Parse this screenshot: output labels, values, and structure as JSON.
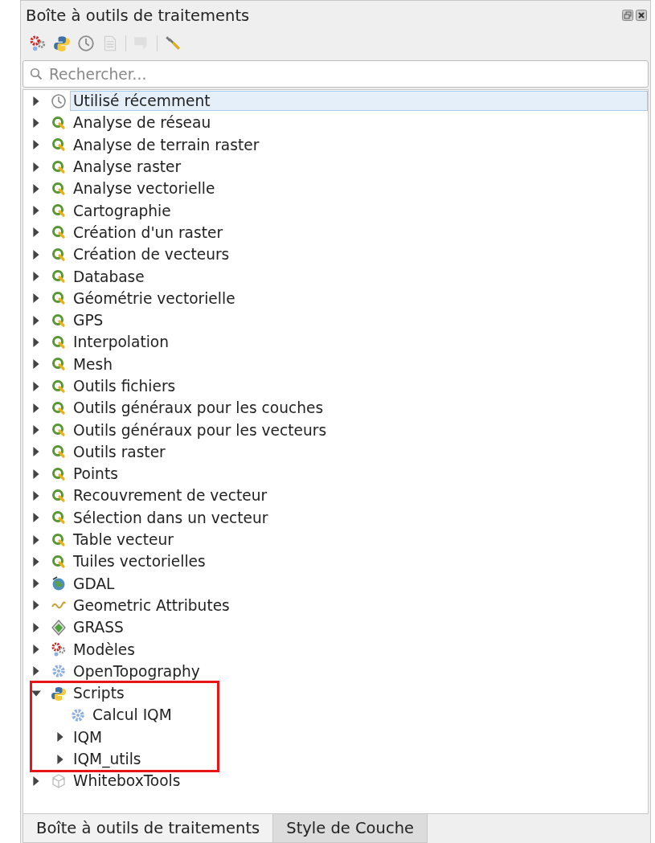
{
  "panel": {
    "title": "Boîte à outils de traitements"
  },
  "toolbar": [
    {
      "kind": "models",
      "disabled": false
    },
    {
      "kind": "python",
      "disabled": false
    },
    {
      "kind": "history",
      "disabled": false
    },
    {
      "kind": "results",
      "disabled": true
    },
    {
      "kind": "separator"
    },
    {
      "kind": "edit",
      "disabled": true
    },
    {
      "kind": "separator"
    },
    {
      "kind": "options",
      "disabled": false
    }
  ],
  "search": {
    "placeholder": "Rechercher..."
  },
  "tree": [
    {
      "label": "Utilisé récemment",
      "kind": "clock",
      "expandable": true,
      "expanded": false,
      "selected": true,
      "annotated": false
    },
    {
      "label": "Analyse de réseau",
      "kind": "qgis",
      "expandable": true,
      "expanded": false,
      "selected": false,
      "annotated": false
    },
    {
      "label": "Analyse de terrain raster",
      "kind": "qgis",
      "expandable": true,
      "expanded": false,
      "selected": false,
      "annotated": false
    },
    {
      "label": "Analyse raster",
      "kind": "qgis",
      "expandable": true,
      "expanded": false,
      "selected": false,
      "annotated": false
    },
    {
      "label": "Analyse vectorielle",
      "kind": "qgis",
      "expandable": true,
      "expanded": false,
      "selected": false,
      "annotated": false
    },
    {
      "label": "Cartographie",
      "kind": "qgis",
      "expandable": true,
      "expanded": false,
      "selected": false,
      "annotated": false
    },
    {
      "label": "Création d'un raster",
      "kind": "qgis",
      "expandable": true,
      "expanded": false,
      "selected": false,
      "annotated": false
    },
    {
      "label": "Création de vecteurs",
      "kind": "qgis",
      "expandable": true,
      "expanded": false,
      "selected": false,
      "annotated": false
    },
    {
      "label": "Database",
      "kind": "qgis",
      "expandable": true,
      "expanded": false,
      "selected": false,
      "annotated": false
    },
    {
      "label": "Géométrie vectorielle",
      "kind": "qgis",
      "expandable": true,
      "expanded": false,
      "selected": false,
      "annotated": false
    },
    {
      "label": "GPS",
      "kind": "qgis",
      "expandable": true,
      "expanded": false,
      "selected": false,
      "annotated": false
    },
    {
      "label": "Interpolation",
      "kind": "qgis",
      "expandable": true,
      "expanded": false,
      "selected": false,
      "annotated": false
    },
    {
      "label": "Mesh",
      "kind": "qgis",
      "expandable": true,
      "expanded": false,
      "selected": false,
      "annotated": false
    },
    {
      "label": "Outils fichiers",
      "kind": "qgis",
      "expandable": true,
      "expanded": false,
      "selected": false,
      "annotated": false
    },
    {
      "label": "Outils généraux pour les couches",
      "kind": "qgis",
      "expandable": true,
      "expanded": false,
      "selected": false,
      "annotated": false
    },
    {
      "label": "Outils généraux pour les vecteurs",
      "kind": "qgis",
      "expandable": true,
      "expanded": false,
      "selected": false,
      "annotated": false
    },
    {
      "label": "Outils raster",
      "kind": "qgis",
      "expandable": true,
      "expanded": false,
      "selected": false,
      "annotated": false
    },
    {
      "label": "Points",
      "kind": "qgis",
      "expandable": true,
      "expanded": false,
      "selected": false,
      "annotated": false
    },
    {
      "label": "Recouvrement de vecteur",
      "kind": "qgis",
      "expandable": true,
      "expanded": false,
      "selected": false,
      "annotated": false
    },
    {
      "label": "Sélection dans un vecteur",
      "kind": "qgis",
      "expandable": true,
      "expanded": false,
      "selected": false,
      "annotated": false
    },
    {
      "label": "Table vecteur",
      "kind": "qgis",
      "expandable": true,
      "expanded": false,
      "selected": false,
      "annotated": false
    },
    {
      "label": "Tuiles vectorielles",
      "kind": "qgis",
      "expandable": true,
      "expanded": false,
      "selected": false,
      "annotated": false
    },
    {
      "label": "GDAL",
      "kind": "gdal",
      "expandable": true,
      "expanded": false,
      "selected": false,
      "annotated": false
    },
    {
      "label": "Geometric Attributes",
      "kind": "wave",
      "expandable": true,
      "expanded": false,
      "selected": false,
      "annotated": false
    },
    {
      "label": "GRASS",
      "kind": "grass",
      "expandable": true,
      "expanded": false,
      "selected": false,
      "annotated": false
    },
    {
      "label": "Modèles",
      "kind": "models",
      "expandable": true,
      "expanded": false,
      "selected": false,
      "annotated": false
    },
    {
      "label": "OpenTopography",
      "kind": "gear",
      "expandable": true,
      "expanded": false,
      "selected": false,
      "annotated": false
    },
    {
      "label": "Scripts",
      "kind": "python",
      "expandable": true,
      "expanded": true,
      "selected": false,
      "annotated": true,
      "children": [
        {
          "label": "Calcul IQM",
          "kind": "gear",
          "expandable": false,
          "selected": false
        },
        {
          "label": "IQM",
          "kind": "folder",
          "expandable": true,
          "expanded": false,
          "selected": false
        },
        {
          "label": "IQM_utils",
          "kind": "folder",
          "expandable": true,
          "expanded": false,
          "selected": false
        }
      ]
    },
    {
      "label": "WhiteboxTools",
      "kind": "whitebox",
      "expandable": true,
      "expanded": false,
      "selected": false,
      "annotated": false
    }
  ],
  "tabs": [
    {
      "label": "Boîte à outils de traitements",
      "selected": true
    },
    {
      "label": "Style de Couche",
      "selected": false
    }
  ]
}
